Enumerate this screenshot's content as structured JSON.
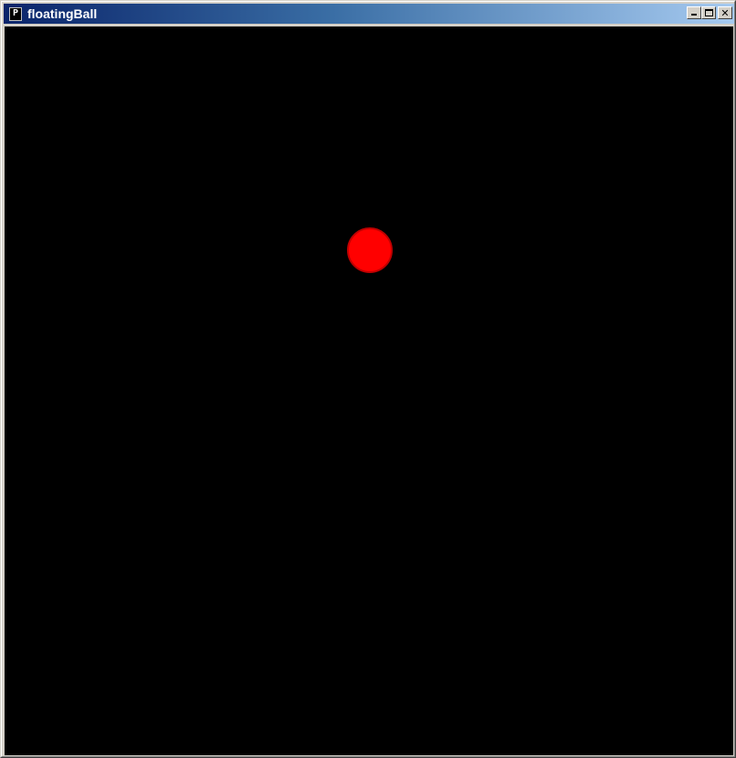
{
  "window": {
    "title": "floatingBall",
    "icon": "processing-icon",
    "icon_glyph": "P",
    "buttons": {
      "minimize_icon": "minimize-icon",
      "maximize_icon": "maximize-icon",
      "close_icon": "close-icon",
      "close_glyph": "✕"
    }
  },
  "sketch": {
    "background_color": "#000000",
    "ball_color": "#ff0000"
  },
  "colors": {
    "titlebar_start": "#0a246a",
    "titlebar_end": "#a6caf0"
  }
}
